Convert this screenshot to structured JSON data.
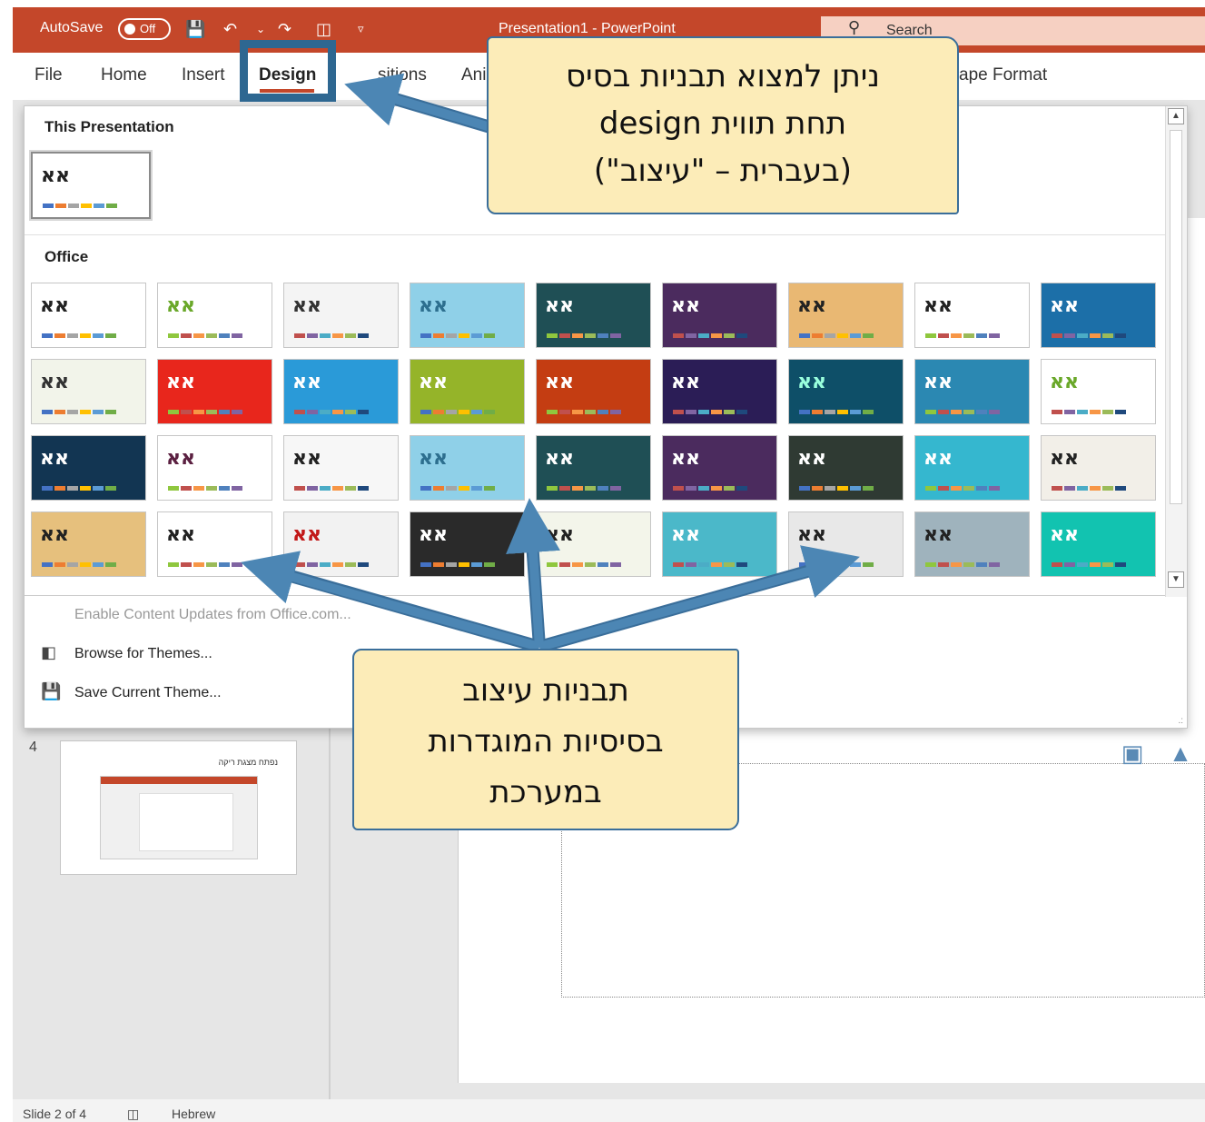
{
  "titlebar": {
    "autosave_label": "AutoSave",
    "autosave_state": "Off",
    "window_title": "Presentation1  -  PowerPoint",
    "search_placeholder": "Search"
  },
  "ribbon_tabs": [
    "File",
    "Home",
    "Insert",
    "Design",
    "Transitions",
    "Animations",
    "Shape Format"
  ],
  "visible_tab_text": {
    "transitions": "sitions",
    "animations": "Ani",
    "shape_format": "ape Format"
  },
  "active_tab": "Design",
  "gallery": {
    "section_this_presentation": "This Presentation",
    "section_office": "Office",
    "theme_preview_text": "אא",
    "menu": {
      "enable_updates": "Enable Content Updates from Office.com...",
      "browse_themes": "Browse for Themes...",
      "save_theme": "Save Current Theme..."
    }
  },
  "thumbnail": {
    "slide_number": "4",
    "title": "נפתח מצגת ריקה"
  },
  "status": {
    "slide_of": "Slide 2 of 4",
    "language": "Hebrew"
  },
  "callouts": {
    "top": [
      "ניתן למצוא תבניות בסיס",
      "תחת תווית design",
      "(בעברית – \"עיצוב\")"
    ],
    "bottom": [
      "תבניות עיצוב",
      "בסיסיות המוגדרות",
      "במערכת"
    ]
  },
  "colors": {
    "titlebar": "#c4472a",
    "callout_fill": "#fcecb8",
    "arrow": "#4c86b4"
  }
}
